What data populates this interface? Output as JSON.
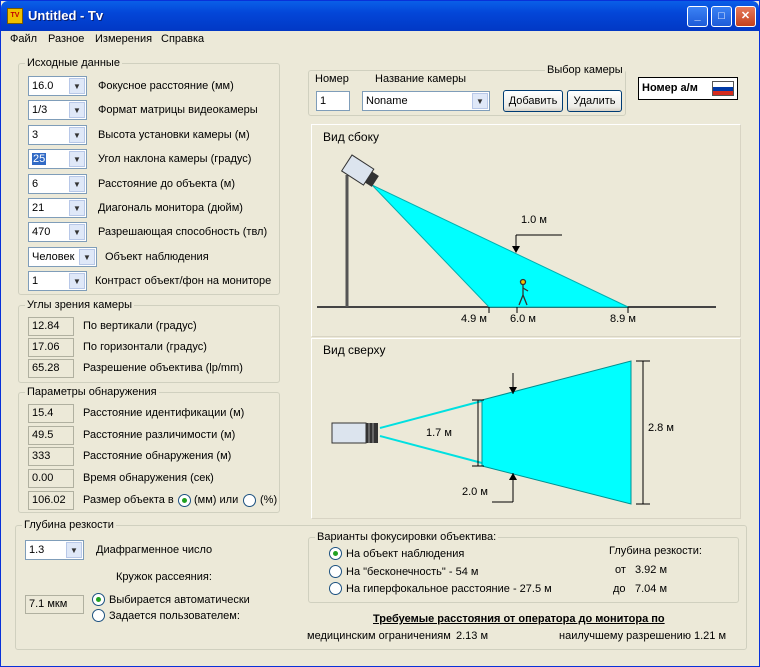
{
  "window": {
    "title": "Untitled - Tv",
    "app_icon": "tv-icon"
  },
  "menu": [
    "Файл",
    "Разное",
    "Измерения",
    "Справка"
  ],
  "source": {
    "title": "Исходные данные",
    "rows": [
      {
        "value": "16.0",
        "label": "Фокусное расстояние (мм)"
      },
      {
        "value": "1/3",
        "label": "Формат матрицы видеокамеры"
      },
      {
        "value": "3",
        "label": "Высота установки камеры (м)"
      },
      {
        "value": "25",
        "label": "Угол наклона камеры (градус)"
      },
      {
        "value": "6",
        "label": "Расстояние до объекта (м)"
      },
      {
        "value": "21",
        "label": "Диагональ монитора (дюйм)"
      },
      {
        "value": "470",
        "label": "Разрешающая способность (твл)"
      },
      {
        "value": "Человек",
        "label": "Объект наблюдения"
      },
      {
        "value": "1",
        "label": "Контраст объект/фон на мониторе"
      }
    ]
  },
  "angles": {
    "title": "Углы зрения камеры",
    "rows": [
      {
        "value": "12.84",
        "label": "По вертикали (градус)"
      },
      {
        "value": "17.06",
        "label": "По горизонтали (градус)"
      },
      {
        "value": "65.28",
        "label": "Разрешение объектива (lp/mm)"
      }
    ]
  },
  "detection": {
    "title": "Параметры обнаружения",
    "rows": [
      {
        "value": "15.4",
        "label": "Расстояние идентификации (м)"
      },
      {
        "value": "49.5",
        "label": "Расстояние различимости (м)"
      },
      {
        "value": "333",
        "label": "Расстояние обнаружения (м)"
      },
      {
        "value": "0.00",
        "label": "Время обнаружения (сек)"
      },
      {
        "value": "106.02",
        "label": "Размер объекта в"
      }
    ],
    "unit_mm": "(мм) или",
    "unit_pct": "(%)"
  },
  "camera_select": {
    "title": "Выбор камеры",
    "number_label": "Номер",
    "name_label": "Название камеры",
    "number_value": "1",
    "name_value": "Noname",
    "add_button": "Добавить",
    "delete_button": "Удалить"
  },
  "plate_button": "Номер а/м",
  "side_view": {
    "title": "Вид сбоку",
    "height_label": "1.0 м",
    "near_label": "4.9 м",
    "object_label": "6.0 м",
    "far_label": "8.9 м"
  },
  "top_view": {
    "title": "Вид сверху",
    "near_width_label": "1.7 м",
    "far_width_label": "2.8 м",
    "object_width_label": "2.0 м"
  },
  "dof": {
    "title": "Глубина резкости",
    "aperture_value": "1.3",
    "aperture_label": "Диафрагменное число",
    "circle_label": "Кружок рассеяния:",
    "circle_value": "7.1 мкм",
    "auto_label": "Выбирается автоматически",
    "user_label": "Задается пользователем:"
  },
  "focus": {
    "title": "Варианты фокусировки объектива:",
    "options": [
      "На объект наблюдения",
      "На \"бесконечность\" -  54 м",
      "На гиперфокальное расстояние -  27.5 м"
    ],
    "depth_title": "Глубина резкости:",
    "from_label": "от",
    "from_value": "3.92 м",
    "to_label": "до",
    "to_value": "7.04 м"
  },
  "operator": {
    "title": "Требуемые расстояния от оператора до монитора по",
    "medical_label": "медицинским ограничениям",
    "medical_value": "2.13 м",
    "best_label": "наилучшему разрешению",
    "best_value": "1.21 м"
  },
  "colors": {
    "beam": "#00ffff",
    "titlebar": "#0346d8"
  }
}
